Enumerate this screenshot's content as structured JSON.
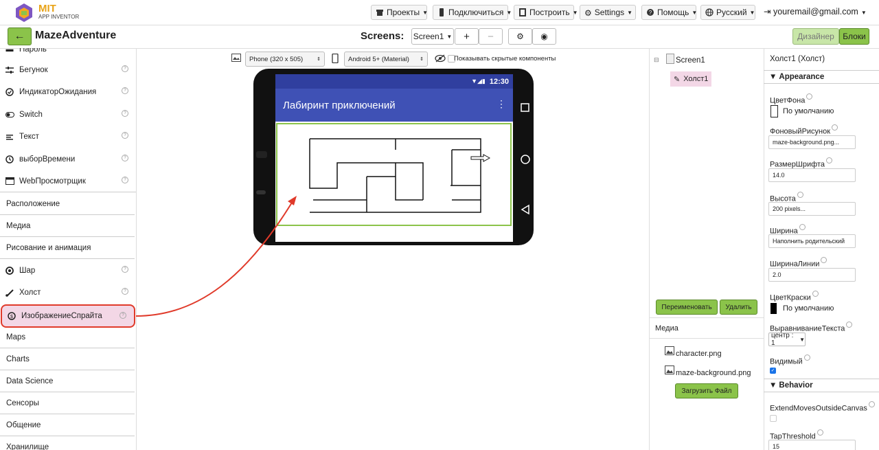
{
  "logo": {
    "mit": "MIT",
    "sub": "APP INVENTOR"
  },
  "topmenu": {
    "projects": "Проекты",
    "connect": "Подключиться",
    "build": "Построить",
    "settings": "Settings",
    "help": "Помощь",
    "language": "Русский",
    "user": "youremail@gmail.com"
  },
  "project": {
    "name": "MazeAdventure"
  },
  "screens": {
    "label": "Screens:",
    "current": "Screen1",
    "add": "+",
    "remove": "−"
  },
  "mode": {
    "designer": "Дизайнер",
    "blocks": "Блоки"
  },
  "palette": {
    "top_cut": "Пароль",
    "items1": [
      {
        "label": "Бегунок",
        "icon": "slider-icon"
      },
      {
        "label": "ИндикаторОжидания",
        "icon": "spinner-icon"
      },
      {
        "label": "Switch",
        "icon": "switch-icon"
      },
      {
        "label": "Текст",
        "icon": "text-icon"
      },
      {
        "label": "выборВремени",
        "icon": "clock-icon"
      },
      {
        "label": "WebПросмотрщик",
        "icon": "web-icon"
      }
    ],
    "cats1": [
      "Расположение",
      "Медиа",
      "Рисование и анимация"
    ],
    "items2": [
      {
        "label": "Шар",
        "icon": "ball-icon"
      },
      {
        "label": "Холст",
        "icon": "canvas-icon"
      },
      {
        "label": "ИзображениеСпрайта",
        "icon": "sprite-icon"
      }
    ],
    "cats2": [
      "Maps",
      "Charts",
      "Data Science",
      "Сенсоры",
      "Общение",
      "Хранилище"
    ]
  },
  "viewer": {
    "phone_size": "Phone (320 x 505)",
    "theme": "Android 5+ (Material)",
    "hidden_label": "Показывать скрытые компоненты",
    "time": "12:30",
    "app_title": "Лабиринт приключений"
  },
  "tree": {
    "root": "Screen1",
    "child": "Холст1",
    "rename": "Переименовать",
    "delete": "Удалить",
    "media_title": "Медиа",
    "media": [
      "character.png",
      "maze-background.png"
    ],
    "upload": "Загрузить Файл"
  },
  "props": {
    "title": "Холст1 (Холст)",
    "appearance": "Appearance",
    "bgcolor_label": "ЦветФона",
    "bgcolor_value": "По умолчанию",
    "bgimage_label": "ФоновыйРисунок",
    "bgimage_value": "maze-background.png...",
    "fontsize_label": "РазмерШрифта",
    "fontsize_value": "14.0",
    "height_label": "Высота",
    "height_value": "200 pixels...",
    "width_label": "Ширина",
    "width_value": "Наполнить родительский",
    "linewidth_label": "ШиринаЛинии",
    "linewidth_value": "2.0",
    "paint_label": "ЦветКраски",
    "paint_value": "По умолчанию",
    "align_label": "ВыравниваниеТекста",
    "align_value": "центр : 1",
    "visible_label": "Видимый",
    "behavior": "Behavior",
    "extend_label": "ExtendMovesOutsideCanvas",
    "tap_label": "TapThreshold",
    "tap_value": "15"
  },
  "colors": {
    "accent_green": "#8bc34a",
    "highlight": "#f3d7e6",
    "appbar": "#3f51b5",
    "statusbar": "#303f9f",
    "arrow": "#e03a2a"
  }
}
